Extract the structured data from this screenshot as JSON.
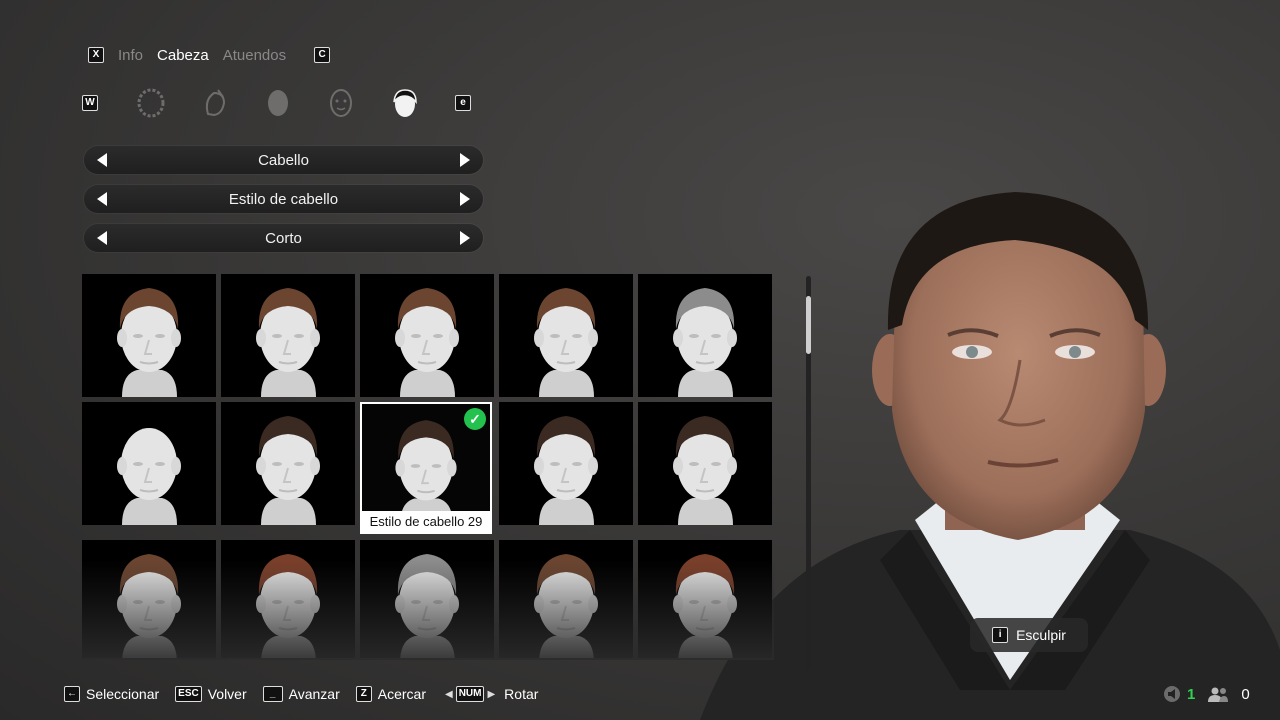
{
  "tabs": {
    "prev_key": "X",
    "next_key": "C",
    "items": [
      {
        "label": "Info",
        "active": false
      },
      {
        "label": "Cabeza",
        "active": true
      },
      {
        "label": "Atuendos",
        "active": false
      }
    ]
  },
  "category_icons": {
    "prev_key": "W",
    "next_key": "e",
    "items": [
      "head-outline-icon",
      "face-feature-icon",
      "head-shape-icon",
      "face-detail-icon",
      "hair-icon"
    ],
    "active": "hair-icon"
  },
  "selectors": [
    {
      "value": "Cabello"
    },
    {
      "value": "Estilo de cabello"
    },
    {
      "value": "Corto"
    }
  ],
  "hair_grid": {
    "selected_caption": "Estilo de cabello 29",
    "hair_colors": {
      "brown": "#6b4530",
      "dark": "#3a2a22",
      "buzz": "#8c8c8c",
      "bald": "#e3e3e3",
      "red": "#7a3f2a"
    }
  },
  "sculpt_button": {
    "key": "i",
    "label": "Esculpir"
  },
  "footer": {
    "hints": [
      {
        "key": "←",
        "label": "Seleccionar"
      },
      {
        "key": "ESC",
        "label": "Volver"
      },
      {
        "key": "_",
        "label": "Avanzar"
      },
      {
        "key": "Z",
        "label": "Acercar"
      },
      {
        "key": "NUM",
        "label": "Rotar"
      }
    ]
  },
  "status": {
    "count_a": "1",
    "count_b": "0",
    "accent": "#2fd04f"
  }
}
